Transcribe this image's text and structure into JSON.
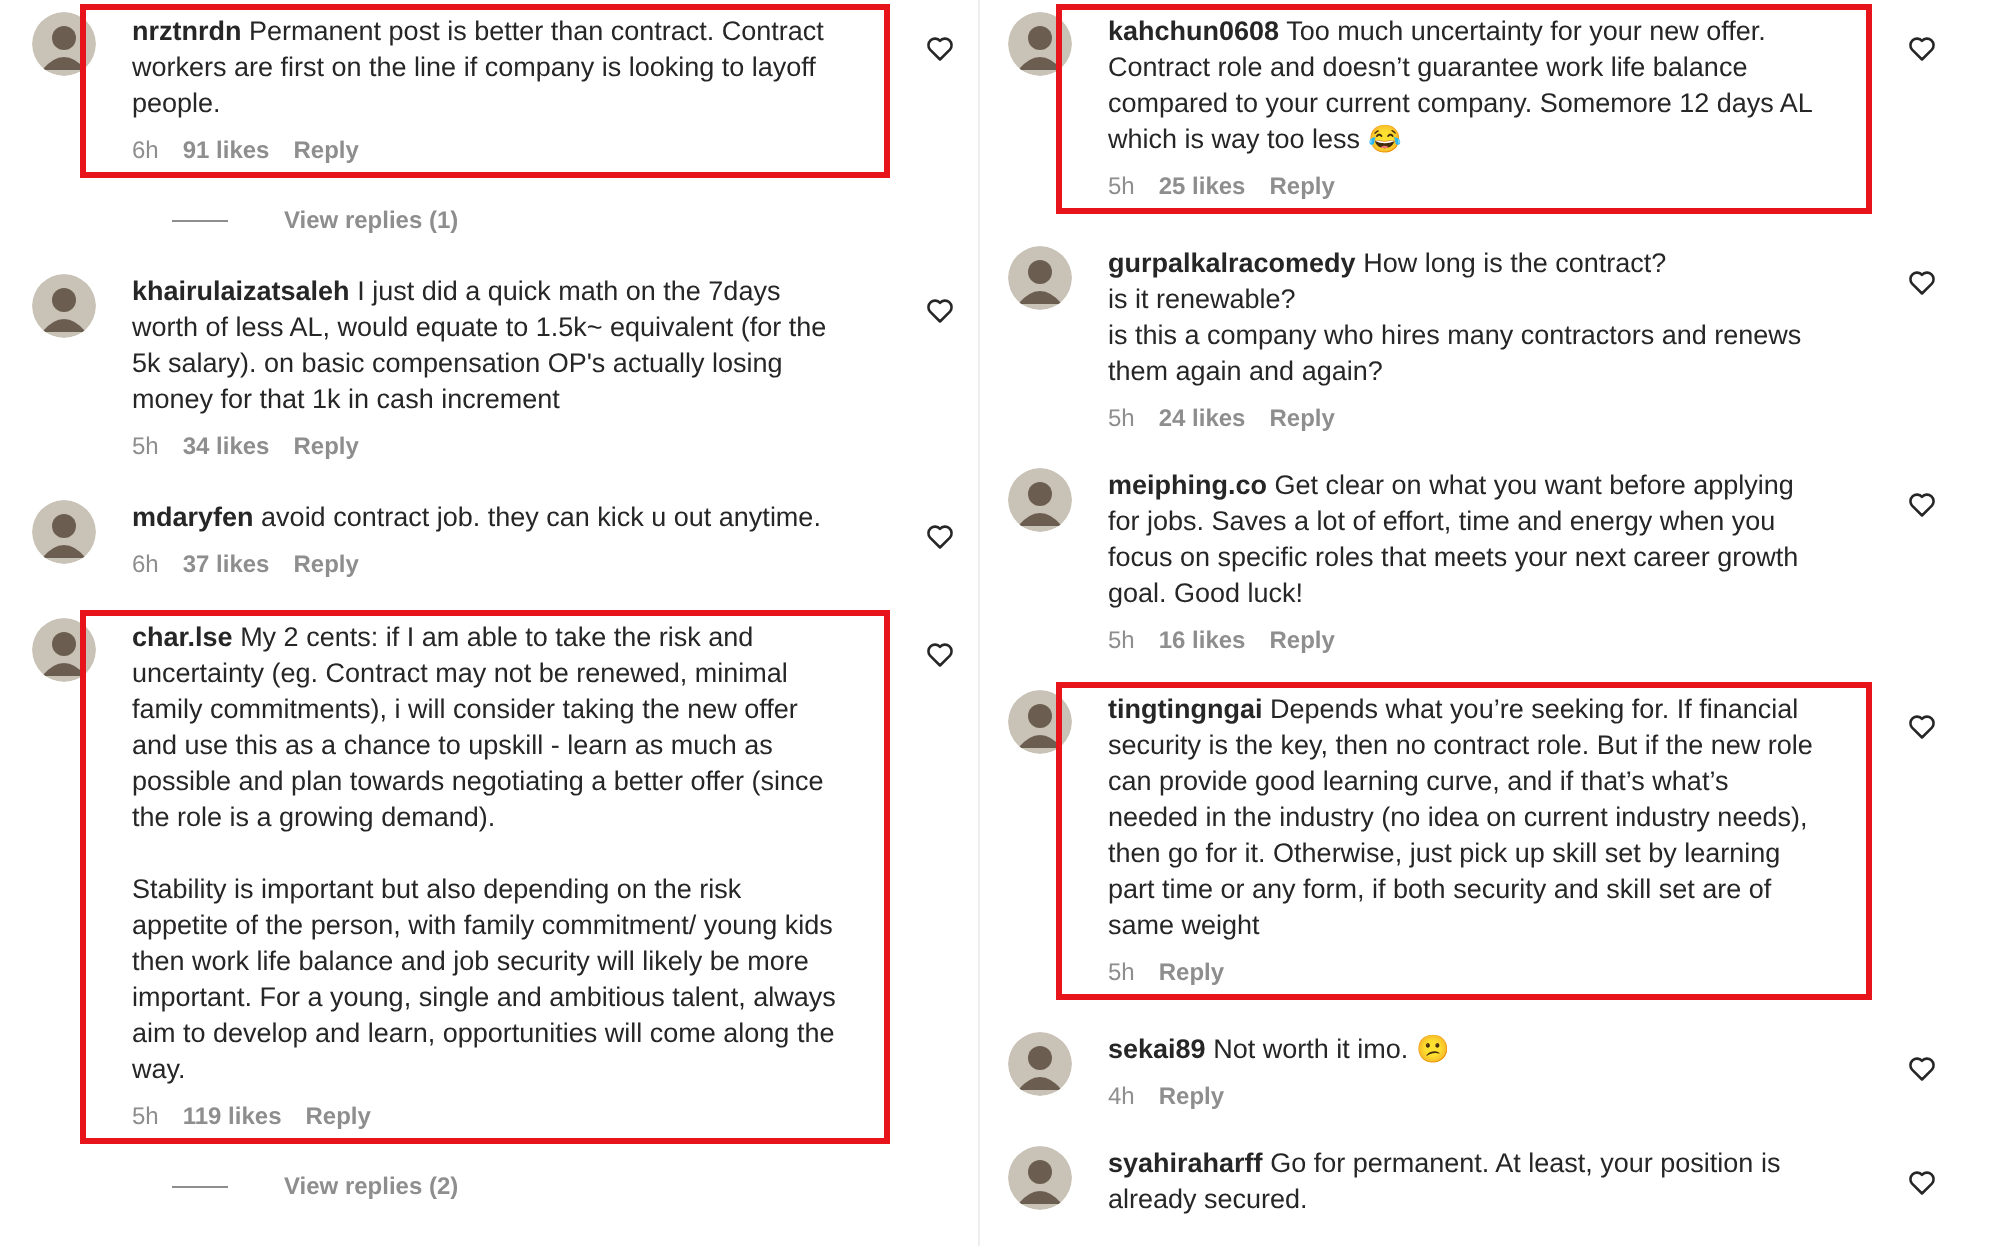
{
  "columns": [
    {
      "comments": [
        {
          "username": "nrztnrdn",
          "text": "Permanent post is better than contract. Contract workers are first on the line if company is looking to layoff people.",
          "time": "6h",
          "likes": "91 likes",
          "reply": "Reply",
          "highlighted": true,
          "view_replies": "View replies (1)"
        },
        {
          "username": "khairulaizatsaleh",
          "text": "I just did a quick math on the 7days worth of less AL, would equate to 1.5k~ equivalent (for the 5k salary). on basic compensation OP's actually losing money for that 1k in cash increment",
          "time": "5h",
          "likes": "34 likes",
          "reply": "Reply",
          "highlighted": false
        },
        {
          "username": "mdaryfen",
          "text": "avoid contract job. they can kick u out anytime.",
          "time": "6h",
          "likes": "37 likes",
          "reply": "Reply",
          "highlighted": false
        },
        {
          "username": "char.lse",
          "text": "My 2 cents: if I am able to take the risk and uncertainty (eg. Contract may not be renewed, minimal family commitments), i will consider taking the new offer and use this as a chance to upskill - learn as much as possible and plan towards negotiating a better offer (since the role is a growing demand).",
          "text2": "Stability is important but also depending on the risk appetite of the person, with family commitment/ young kids then work life balance and job security will likely be more important. For a young, single and ambitious talent, always aim to develop and learn, opportunities will come along the way.",
          "time": "5h",
          "likes": "119 likes",
          "reply": "Reply",
          "highlighted": true,
          "view_replies": "View replies (2)"
        }
      ]
    },
    {
      "comments": [
        {
          "username": "kahchun0608",
          "text": "Too much uncertainty for your new offer. Contract role and doesn’t guarantee work life balance compared to your current company. Somemore 12 days AL which is way too less 😂",
          "time": "5h",
          "likes": "25 likes",
          "reply": "Reply",
          "highlighted": true
        },
        {
          "username": "gurpalkalracomedy",
          "text": "How long is the contract?\nis it renewable?\nis this a company who hires many contractors and renews them again and again?",
          "time": "5h",
          "likes": "24 likes",
          "reply": "Reply",
          "highlighted": false
        },
        {
          "username": "meiphing.co",
          "text": "Get clear on what you want before applying for jobs. Saves a lot of effort, time and energy when you focus on specific roles that meets your next career growth goal. Good luck!",
          "time": "5h",
          "likes": "16 likes",
          "reply": "Reply",
          "highlighted": false
        },
        {
          "username": "tingtingngai",
          "text": "Depends what you’re seeking for. If financial security is the key, then no contract role. But if the new role can provide good learning curve, and if that’s what’s needed in the industry (no idea on current industry needs), then go for it. Otherwise, just pick up skill set by learning part time or any form, if both security and skill set are of same weight",
          "time": "5h",
          "reply": "Reply",
          "highlighted": true
        },
        {
          "username": "sekai89",
          "text": "Not worth it imo. 😕",
          "time": "4h",
          "reply": "Reply",
          "highlighted": false
        },
        {
          "username": "syahiraharff",
          "text": "Go for permanent. At least, your position is already secured.",
          "highlighted": false
        }
      ]
    }
  ]
}
